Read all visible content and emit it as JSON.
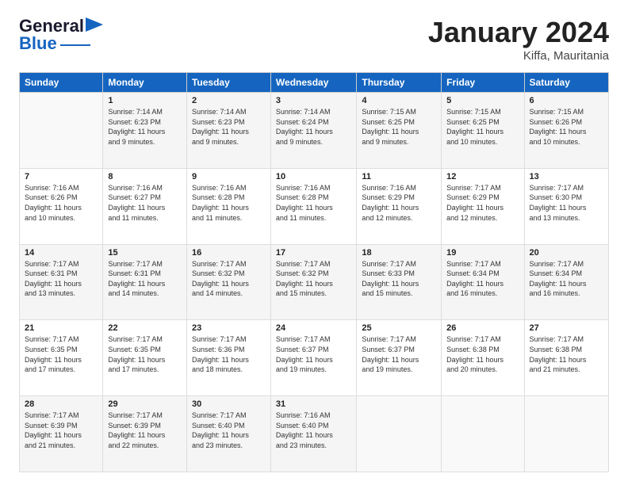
{
  "logo": {
    "line1": "General",
    "line2": "Blue"
  },
  "header": {
    "title": "January 2024",
    "subtitle": "Kiffa, Mauritania"
  },
  "days_of_week": [
    "Sunday",
    "Monday",
    "Tuesday",
    "Wednesday",
    "Thursday",
    "Friday",
    "Saturday"
  ],
  "weeks": [
    [
      {
        "day": "",
        "info": ""
      },
      {
        "day": "1",
        "info": "Sunrise: 7:14 AM\nSunset: 6:23 PM\nDaylight: 11 hours\nand 9 minutes."
      },
      {
        "day": "2",
        "info": "Sunrise: 7:14 AM\nSunset: 6:23 PM\nDaylight: 11 hours\nand 9 minutes."
      },
      {
        "day": "3",
        "info": "Sunrise: 7:14 AM\nSunset: 6:24 PM\nDaylight: 11 hours\nand 9 minutes."
      },
      {
        "day": "4",
        "info": "Sunrise: 7:15 AM\nSunset: 6:25 PM\nDaylight: 11 hours\nand 9 minutes."
      },
      {
        "day": "5",
        "info": "Sunrise: 7:15 AM\nSunset: 6:25 PM\nDaylight: 11 hours\nand 10 minutes."
      },
      {
        "day": "6",
        "info": "Sunrise: 7:15 AM\nSunset: 6:26 PM\nDaylight: 11 hours\nand 10 minutes."
      }
    ],
    [
      {
        "day": "7",
        "info": "Sunrise: 7:16 AM\nSunset: 6:26 PM\nDaylight: 11 hours\nand 10 minutes."
      },
      {
        "day": "8",
        "info": "Sunrise: 7:16 AM\nSunset: 6:27 PM\nDaylight: 11 hours\nand 11 minutes."
      },
      {
        "day": "9",
        "info": "Sunrise: 7:16 AM\nSunset: 6:28 PM\nDaylight: 11 hours\nand 11 minutes."
      },
      {
        "day": "10",
        "info": "Sunrise: 7:16 AM\nSunset: 6:28 PM\nDaylight: 11 hours\nand 11 minutes."
      },
      {
        "day": "11",
        "info": "Sunrise: 7:16 AM\nSunset: 6:29 PM\nDaylight: 11 hours\nand 12 minutes."
      },
      {
        "day": "12",
        "info": "Sunrise: 7:17 AM\nSunset: 6:29 PM\nDaylight: 11 hours\nand 12 minutes."
      },
      {
        "day": "13",
        "info": "Sunrise: 7:17 AM\nSunset: 6:30 PM\nDaylight: 11 hours\nand 13 minutes."
      }
    ],
    [
      {
        "day": "14",
        "info": "Sunrise: 7:17 AM\nSunset: 6:31 PM\nDaylight: 11 hours\nand 13 minutes."
      },
      {
        "day": "15",
        "info": "Sunrise: 7:17 AM\nSunset: 6:31 PM\nDaylight: 11 hours\nand 14 minutes."
      },
      {
        "day": "16",
        "info": "Sunrise: 7:17 AM\nSunset: 6:32 PM\nDaylight: 11 hours\nand 14 minutes."
      },
      {
        "day": "17",
        "info": "Sunrise: 7:17 AM\nSunset: 6:32 PM\nDaylight: 11 hours\nand 15 minutes."
      },
      {
        "day": "18",
        "info": "Sunrise: 7:17 AM\nSunset: 6:33 PM\nDaylight: 11 hours\nand 15 minutes."
      },
      {
        "day": "19",
        "info": "Sunrise: 7:17 AM\nSunset: 6:34 PM\nDaylight: 11 hours\nand 16 minutes."
      },
      {
        "day": "20",
        "info": "Sunrise: 7:17 AM\nSunset: 6:34 PM\nDaylight: 11 hours\nand 16 minutes."
      }
    ],
    [
      {
        "day": "21",
        "info": "Sunrise: 7:17 AM\nSunset: 6:35 PM\nDaylight: 11 hours\nand 17 minutes."
      },
      {
        "day": "22",
        "info": "Sunrise: 7:17 AM\nSunset: 6:35 PM\nDaylight: 11 hours\nand 17 minutes."
      },
      {
        "day": "23",
        "info": "Sunrise: 7:17 AM\nSunset: 6:36 PM\nDaylight: 11 hours\nand 18 minutes."
      },
      {
        "day": "24",
        "info": "Sunrise: 7:17 AM\nSunset: 6:37 PM\nDaylight: 11 hours\nand 19 minutes."
      },
      {
        "day": "25",
        "info": "Sunrise: 7:17 AM\nSunset: 6:37 PM\nDaylight: 11 hours\nand 19 minutes."
      },
      {
        "day": "26",
        "info": "Sunrise: 7:17 AM\nSunset: 6:38 PM\nDaylight: 11 hours\nand 20 minutes."
      },
      {
        "day": "27",
        "info": "Sunrise: 7:17 AM\nSunset: 6:38 PM\nDaylight: 11 hours\nand 21 minutes."
      }
    ],
    [
      {
        "day": "28",
        "info": "Sunrise: 7:17 AM\nSunset: 6:39 PM\nDaylight: 11 hours\nand 21 minutes."
      },
      {
        "day": "29",
        "info": "Sunrise: 7:17 AM\nSunset: 6:39 PM\nDaylight: 11 hours\nand 22 minutes."
      },
      {
        "day": "30",
        "info": "Sunrise: 7:17 AM\nSunset: 6:40 PM\nDaylight: 11 hours\nand 23 minutes."
      },
      {
        "day": "31",
        "info": "Sunrise: 7:16 AM\nSunset: 6:40 PM\nDaylight: 11 hours\nand 23 minutes."
      },
      {
        "day": "",
        "info": ""
      },
      {
        "day": "",
        "info": ""
      },
      {
        "day": "",
        "info": ""
      }
    ]
  ]
}
